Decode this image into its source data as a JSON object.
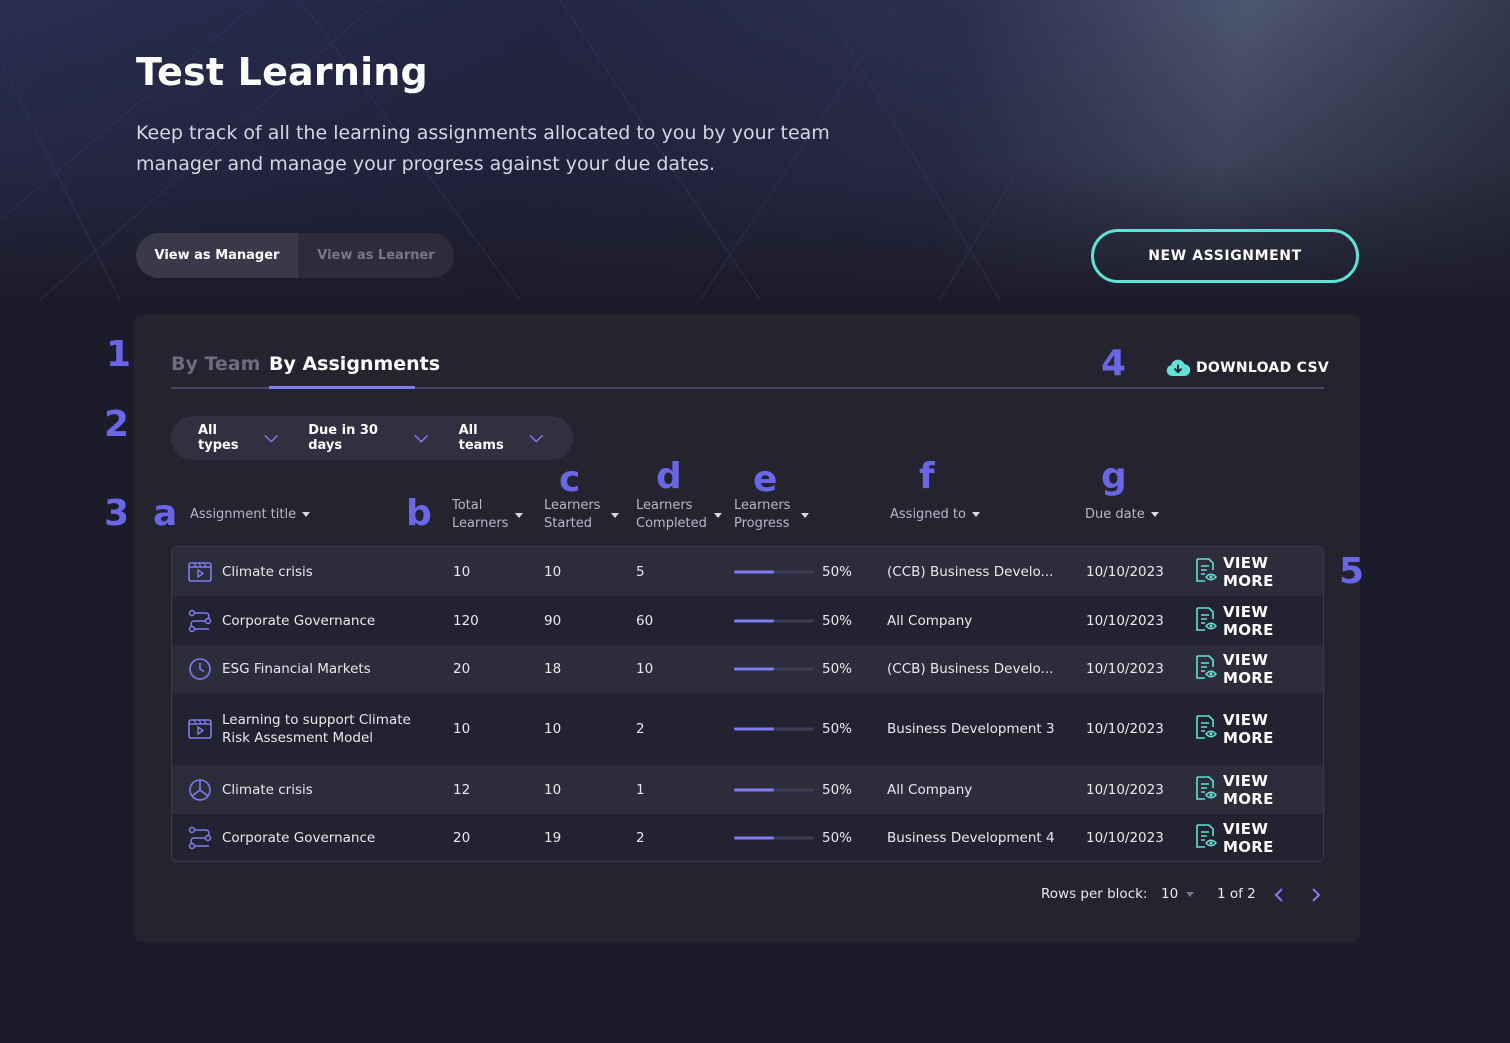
{
  "header": {
    "title": "Test Learning",
    "description": "Keep track of all the learning assignments allocated to you by your team manager and manage your progress against your due dates."
  },
  "view_toggle": {
    "manager_label": "View as Manager",
    "learner_label": "View as Learner",
    "active": "manager"
  },
  "new_assignment_label": "NEW ASSIGNMENT",
  "tabs": {
    "team_label": "By Team",
    "assignments_label": "By Assignments",
    "active": "assignments"
  },
  "download_label": "DOWNLOAD CSV",
  "filters": {
    "type": "All types",
    "due": "Due in 30 days",
    "teams": "All teams"
  },
  "annotations": {
    "numbers": [
      "1",
      "2",
      "3",
      "4",
      "5"
    ],
    "letters": [
      "a",
      "b",
      "c",
      "d",
      "e",
      "f",
      "g"
    ]
  },
  "columns": {
    "title": "Assignment title",
    "total_1": "Total",
    "total_2": "Learners",
    "started_1": "Learners",
    "started_2": "Started",
    "completed_1": "Learners",
    "completed_2": "Completed",
    "progress_1": "Learners",
    "progress_2": "Progress",
    "assigned": "Assigned to",
    "due": "Due date"
  },
  "rows": [
    {
      "icon": "video-icon",
      "title": "Climate crisis",
      "total": "10",
      "started": "10",
      "completed": "5",
      "progress_pct": 50,
      "progress": "50%",
      "assigned": "(CCB) Business Develo...",
      "due": "10/10/2023",
      "action": "VIEW MORE"
    },
    {
      "icon": "pathway-icon",
      "title": "Corporate Governance",
      "total": "120",
      "started": "90",
      "completed": "60",
      "progress_pct": 50,
      "progress": "50%",
      "assigned": "All Company",
      "due": "10/10/2023",
      "action": "VIEW MORE"
    },
    {
      "icon": "clock-icon",
      "title": "ESG Financial Markets",
      "total": "20",
      "started": "18",
      "completed": "10",
      "progress_pct": 50,
      "progress": "50%",
      "assigned": "(CCB) Business Develo...",
      "due": "10/10/2023",
      "action": "VIEW MORE"
    },
    {
      "icon": "video-icon",
      "title": "Learning to support Climate Risk Assesment Model",
      "total": "10",
      "started": "10",
      "completed": "2",
      "progress_pct": 50,
      "progress": "50%",
      "assigned": "Business Development 3",
      "due": "10/10/2023",
      "action": "VIEW MORE"
    },
    {
      "icon": "pie-chart-icon",
      "title": "Climate crisis",
      "total": "12",
      "started": "10",
      "completed": "1",
      "progress_pct": 50,
      "progress": "50%",
      "assigned": "All Company",
      "due": "10/10/2023",
      "action": "VIEW MORE"
    },
    {
      "icon": "pathway-icon",
      "title": "Corporate Governance",
      "total": "20",
      "started": "19",
      "completed": "2",
      "progress_pct": 50,
      "progress": "50%",
      "assigned": "Business Development 4",
      "due": "10/10/2023",
      "action": "VIEW MORE"
    }
  ],
  "pagination": {
    "rows_label": "Rows per block:",
    "rows_value": "10",
    "page_label": "1 of 2"
  },
  "colors": {
    "accent": "#7f7cf0",
    "button_border": "#5fe3d6",
    "annotation": "#6a67e6",
    "background": "#1c1b29"
  }
}
